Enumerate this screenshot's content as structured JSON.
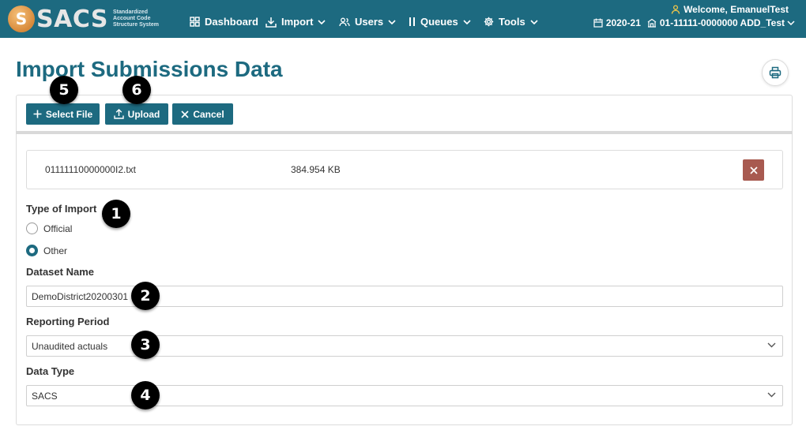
{
  "logo": {
    "word": "SACS",
    "sub1": "Standardized",
    "sub2": "Account Code",
    "sub3": "Structure System",
    "coin_letter": "S"
  },
  "nav": {
    "dashboard": "Dashboard",
    "import": "Import",
    "users": "Users",
    "queues": "Queues",
    "tools": "Tools"
  },
  "user": {
    "welcome": "Welcome, EmanuelTest",
    "fiscal_year": "2020-21",
    "entity": "01-11111-0000000 ADD_Test"
  },
  "page": {
    "title": "Import Submissions Data"
  },
  "toolbar": {
    "select_file": "Select File",
    "upload": "Upload",
    "cancel": "Cancel"
  },
  "file": {
    "name": "01111110000000I2.txt",
    "size": "384.954 KB"
  },
  "form": {
    "type_label": "Type of Import",
    "type_options": [
      "Official",
      "Other"
    ],
    "type_selected": "Other",
    "dataset_label": "Dataset Name",
    "dataset_value": "DemoDistrict20200301",
    "period_label": "Reporting Period",
    "period_value": "Unaudited actuals",
    "datatype_label": "Data Type",
    "datatype_value": "SACS"
  },
  "callouts": [
    "1",
    "2",
    "3",
    "4",
    "5",
    "6"
  ],
  "colors": {
    "brand": "#1d6a80",
    "danger": "#a85a50",
    "badge": "#000000"
  }
}
